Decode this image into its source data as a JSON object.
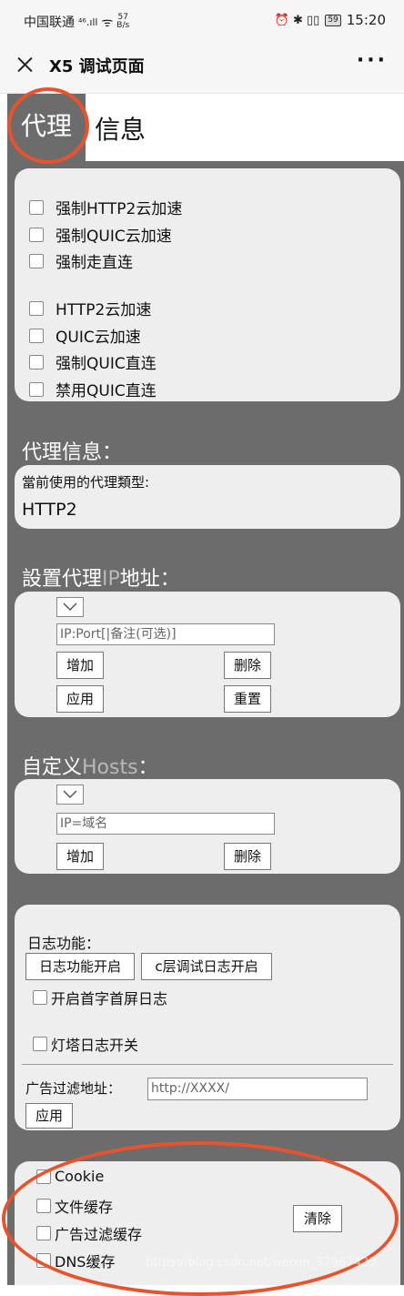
{
  "statusbar": {
    "carrier": "中国联通",
    "signal": "⁴⁶.ıll",
    "wifi": "ᯤ",
    "speed_value": "57",
    "speed_unit": "B/s",
    "icons": "⏰ ✱ ▯▯",
    "battery": "59",
    "time": "15:20"
  },
  "titlebar": {
    "title": "X5 调试页面",
    "more": "···"
  },
  "tabs": [
    {
      "label": "代理",
      "active": true
    },
    {
      "label": "信息",
      "active": false
    }
  ],
  "checkbox_group_1": [
    "强制HTTP2云加速",
    "强制QUIC云加速",
    "强制走直连"
  ],
  "checkbox_group_2": [
    "HTTP2云加速",
    "QUIC云加速",
    "强制QUIC直连",
    "禁用QUIC直连"
  ],
  "proxy_info": {
    "title": "代理信息：",
    "current_label": "當前使用的代理類型:",
    "current_value": "HTTP2"
  },
  "proxy_ip": {
    "title_a": "設置代理",
    "title_b": "IP",
    "title_c": "地址：",
    "placeholder": "IP:Port[|备注(可选)]",
    "add": "增加",
    "delete": "删除",
    "apply": "应用",
    "reset": "重置"
  },
  "hosts": {
    "title_a": "自定义",
    "title_b": "Hosts",
    "title_c": "：",
    "placeholder": "IP=域名",
    "add": "增加",
    "delete": "删除"
  },
  "log": {
    "label": "日志功能：",
    "btn_log_on": "日志功能开启",
    "btn_c_log_on": "c层调试日志开启",
    "first_screen_log": "开启首字首屏日志",
    "lighthouse_log": "灯塔日志开关",
    "ad_filter_label": "广告过滤地址：",
    "ad_filter_placeholder": "http://XXXX/",
    "apply": "应用"
  },
  "cache": {
    "items": [
      "Cookie",
      "文件缓存",
      "广告过滤缓存",
      "DNS缓存"
    ],
    "clear": "清除"
  },
  "watermark": "https://blog.csdn.net/weixin_37967429",
  "colors": {
    "panel_bg": "#6c6c6c",
    "card_bg": "#eeeeee",
    "annotation": "#e8532e"
  }
}
